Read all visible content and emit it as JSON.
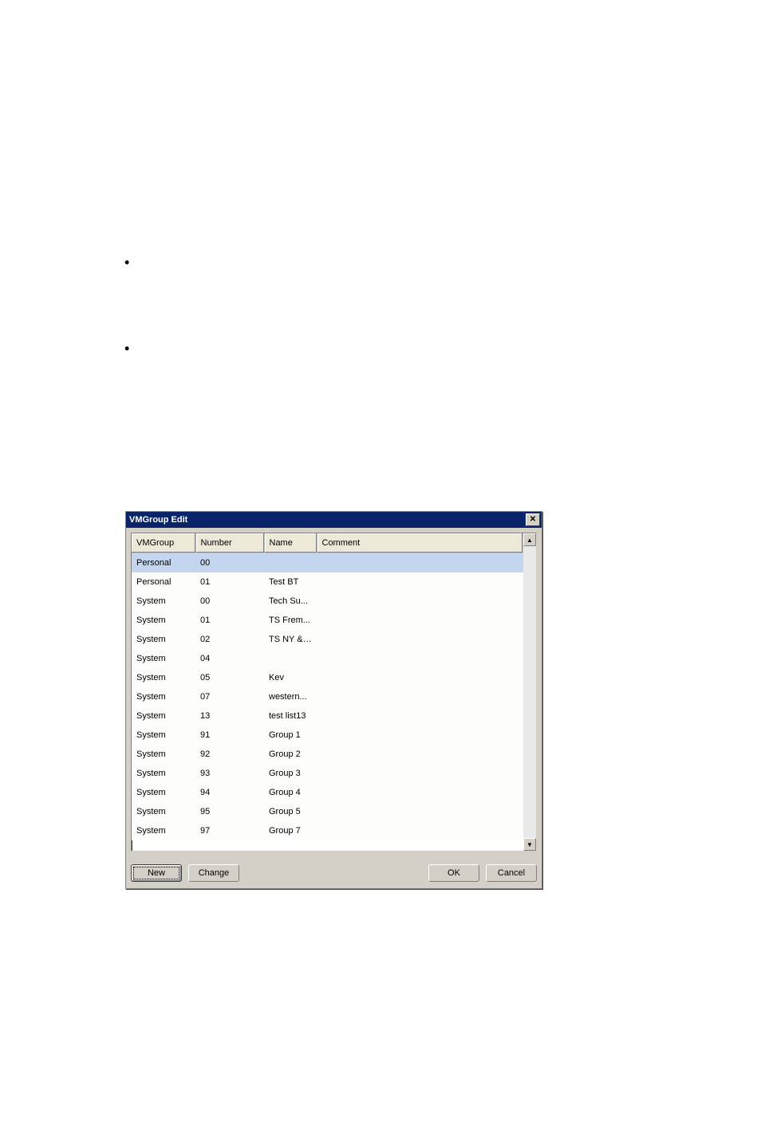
{
  "bullets": [
    "•",
    "•"
  ],
  "dialog": {
    "title": "VMGroup Edit",
    "close": "✕",
    "columns": {
      "vmgroup": "VMGroup",
      "number": "Number",
      "name": "Name",
      "comment": "Comment"
    },
    "rows": [
      {
        "vmgroup": "Personal",
        "number": "00",
        "name": "",
        "comment": "",
        "selected": true
      },
      {
        "vmgroup": "Personal",
        "number": "01",
        "name": "Test BT",
        "comment": ""
      },
      {
        "vmgroup": "System",
        "number": "00",
        "name": "Tech Su...",
        "comment": ""
      },
      {
        "vmgroup": "System",
        "number": "01",
        "name": "TS Frem...",
        "comment": ""
      },
      {
        "vmgroup": "System",
        "number": "02",
        "name": "TS NY &TX",
        "comment": ""
      },
      {
        "vmgroup": "System",
        "number": "04",
        "name": "",
        "comment": ""
      },
      {
        "vmgroup": "System",
        "number": "05",
        "name": "Kev",
        "comment": ""
      },
      {
        "vmgroup": "System",
        "number": "07",
        "name": "western...",
        "comment": ""
      },
      {
        "vmgroup": "System",
        "number": "13",
        "name": "test list13",
        "comment": ""
      },
      {
        "vmgroup": "System",
        "number": "91",
        "name": "Group 1",
        "comment": ""
      },
      {
        "vmgroup": "System",
        "number": "92",
        "name": "Group 2",
        "comment": ""
      },
      {
        "vmgroup": "System",
        "number": "93",
        "name": "Group 3",
        "comment": ""
      },
      {
        "vmgroup": "System",
        "number": "94",
        "name": "Group 4",
        "comment": ""
      },
      {
        "vmgroup": "System",
        "number": "95",
        "name": "Group 5",
        "comment": ""
      },
      {
        "vmgroup": "System",
        "number": "97",
        "name": "Group 7",
        "comment": ""
      }
    ],
    "buttons": {
      "new": "New",
      "change": "Change",
      "ok": "OK",
      "cancel": "Cancel"
    },
    "scroll": {
      "up": "▲",
      "down": "▼"
    }
  }
}
